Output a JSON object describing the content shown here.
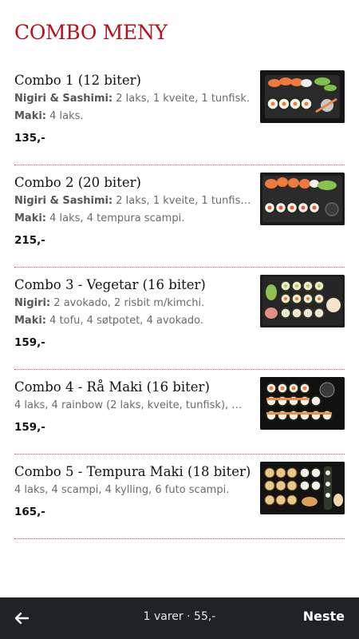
{
  "header": {
    "title": "COMBO MENY"
  },
  "items": [
    {
      "name": "Combo 1 (12 biter)",
      "lines": [
        {
          "label": "Nigiri & Sashimi:",
          "text": " 2 laks, 1 kveite, 1 tunfisk."
        },
        {
          "label": "Maki:",
          "text": " 4 laks."
        }
      ],
      "price": "135,-"
    },
    {
      "name": "Combo 2 (20 biter)",
      "lines": [
        {
          "label": "Nigiri & Sashimi:",
          "text": " 2 laks, 1 kveite, 1 tunfisk…"
        },
        {
          "label": "Maki:",
          "text": " 4 laks, 4 tempura scampi."
        }
      ],
      "price": "215,-"
    },
    {
      "name": "Combo 3 - Vegetar (16 biter)",
      "lines": [
        {
          "label": "Nigiri:",
          "text": " 2 avokado, 2 risbit m/kimchi."
        },
        {
          "label": "Maki:",
          "text": " 4 tofu, 4 søtpotet, 4 avokado."
        }
      ],
      "price": "159,-"
    },
    {
      "name": "Combo 4 - Rå Maki (16 biter)",
      "lines": [
        {
          "label": "",
          "text": "4 laks, 4 rainbow (2 laks, kveite, tunfisk), …"
        }
      ],
      "price": "159,-"
    },
    {
      "name": "Combo 5 - Tempura Maki (18 biter)",
      "lines": [
        {
          "label": "",
          "text": "4 laks, 4 scampi, 4 kylling, 6 futo scampi."
        }
      ],
      "price": "165,-"
    }
  ],
  "footer": {
    "cart_summary": "1 varer · 55,-",
    "next_label": "Neste",
    "back_icon": "arrow-left-icon"
  },
  "colors": {
    "accent": "#b3131c",
    "bar": "#1f2326"
  }
}
